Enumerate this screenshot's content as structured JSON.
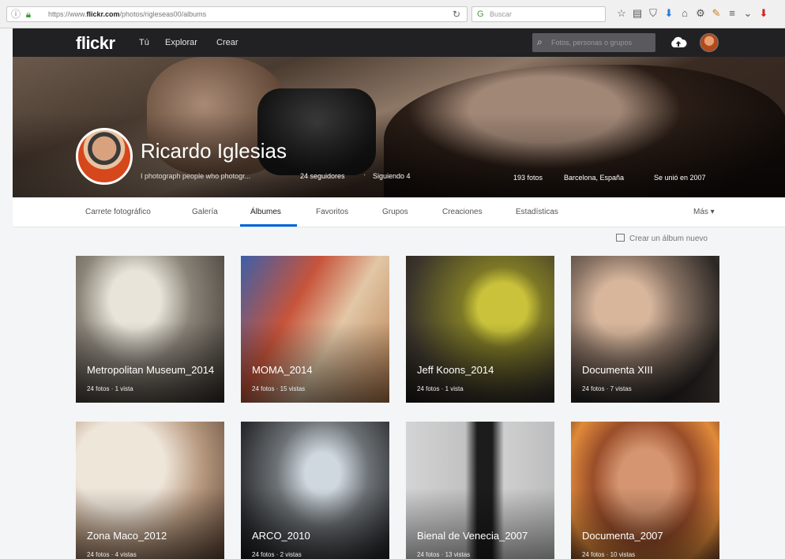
{
  "browser": {
    "url_prefix": "https://www.",
    "url_domain": "flickr.com",
    "url_path": "/photos/rigleseas00/albums",
    "search_placeholder": "Buscar"
  },
  "nav": {
    "logo": "flickr",
    "links": [
      "Tú",
      "Explorar",
      "Crear"
    ],
    "search_placeholder": "Fotos, personas o grupos"
  },
  "profile": {
    "name": "Ricardo Iglesias",
    "bio": "I photograph people who photogr...",
    "followers": "24 seguidores",
    "following": "Siguiendo 4",
    "photos": "193 fotos",
    "location": "Barcelona, España",
    "joined": "Se unió en 2007"
  },
  "tabs": [
    "Carrete fotográfico",
    "Galería",
    "Álbumes",
    "Favoritos",
    "Grupos",
    "Creaciones",
    "Estadísticas"
  ],
  "more_label": "Más ▾",
  "create_album": "Crear un álbum nuevo",
  "albums": [
    {
      "title": "Metropolitan Museum_2014",
      "meta": "24 fotos  ·  1 vista"
    },
    {
      "title": "MOMA_2014",
      "meta": "24 fotos  ·  15 vistas"
    },
    {
      "title": "Jeff Koons_2014",
      "meta": "24 fotos  ·  1 vista"
    },
    {
      "title": "Documenta XIII",
      "meta": "24 fotos  ·  7 vistas"
    },
    {
      "title": "Zona Maco_2012",
      "meta": "24 fotos  ·  4 vistas"
    },
    {
      "title": "ARCO_2010",
      "meta": "24 fotos  ·  2 vistas"
    },
    {
      "title": "Bienal de Venecia_2007",
      "meta": "24 fotos  ·  13 vistas"
    },
    {
      "title": "Documenta_2007",
      "meta": "24 fotos  ·  10 vistas"
    }
  ],
  "colors": {
    "nav_bg": "#212124",
    "accent": "#0063dc",
    "page_bg": "#f3f5f6"
  }
}
